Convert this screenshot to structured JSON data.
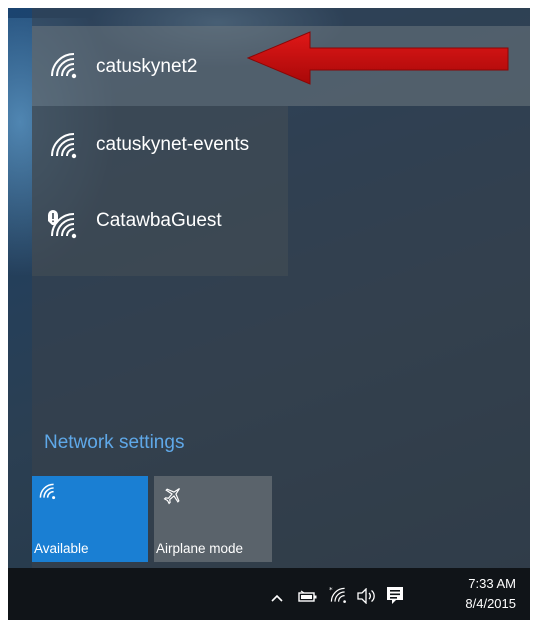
{
  "networks": [
    {
      "name": "catuskynet2",
      "icon": "wifi-icon",
      "state": "selected"
    },
    {
      "name": "catuskynet-events",
      "icon": "wifi-icon",
      "state": "available"
    },
    {
      "name": "CatawbaGuest",
      "icon": "wifi-secured-warning-icon",
      "state": "available"
    }
  ],
  "network_settings_label": "Network settings",
  "tiles": [
    {
      "label": "Available",
      "icon": "wifi-icon",
      "active": true
    },
    {
      "label": "Airplane mode",
      "icon": "airplane-icon",
      "active": false
    }
  ],
  "taskbar": {
    "time": "7:33 AM",
    "date": "8/4/2015",
    "icons": [
      "chevron-up-icon",
      "battery-icon",
      "wifi-icon",
      "volume-icon",
      "action-center-icon"
    ]
  },
  "colors": {
    "accent": "#1a7fd3",
    "link": "#5fa8e8",
    "arrow": "#d01010",
    "taskbar": "#101418"
  }
}
